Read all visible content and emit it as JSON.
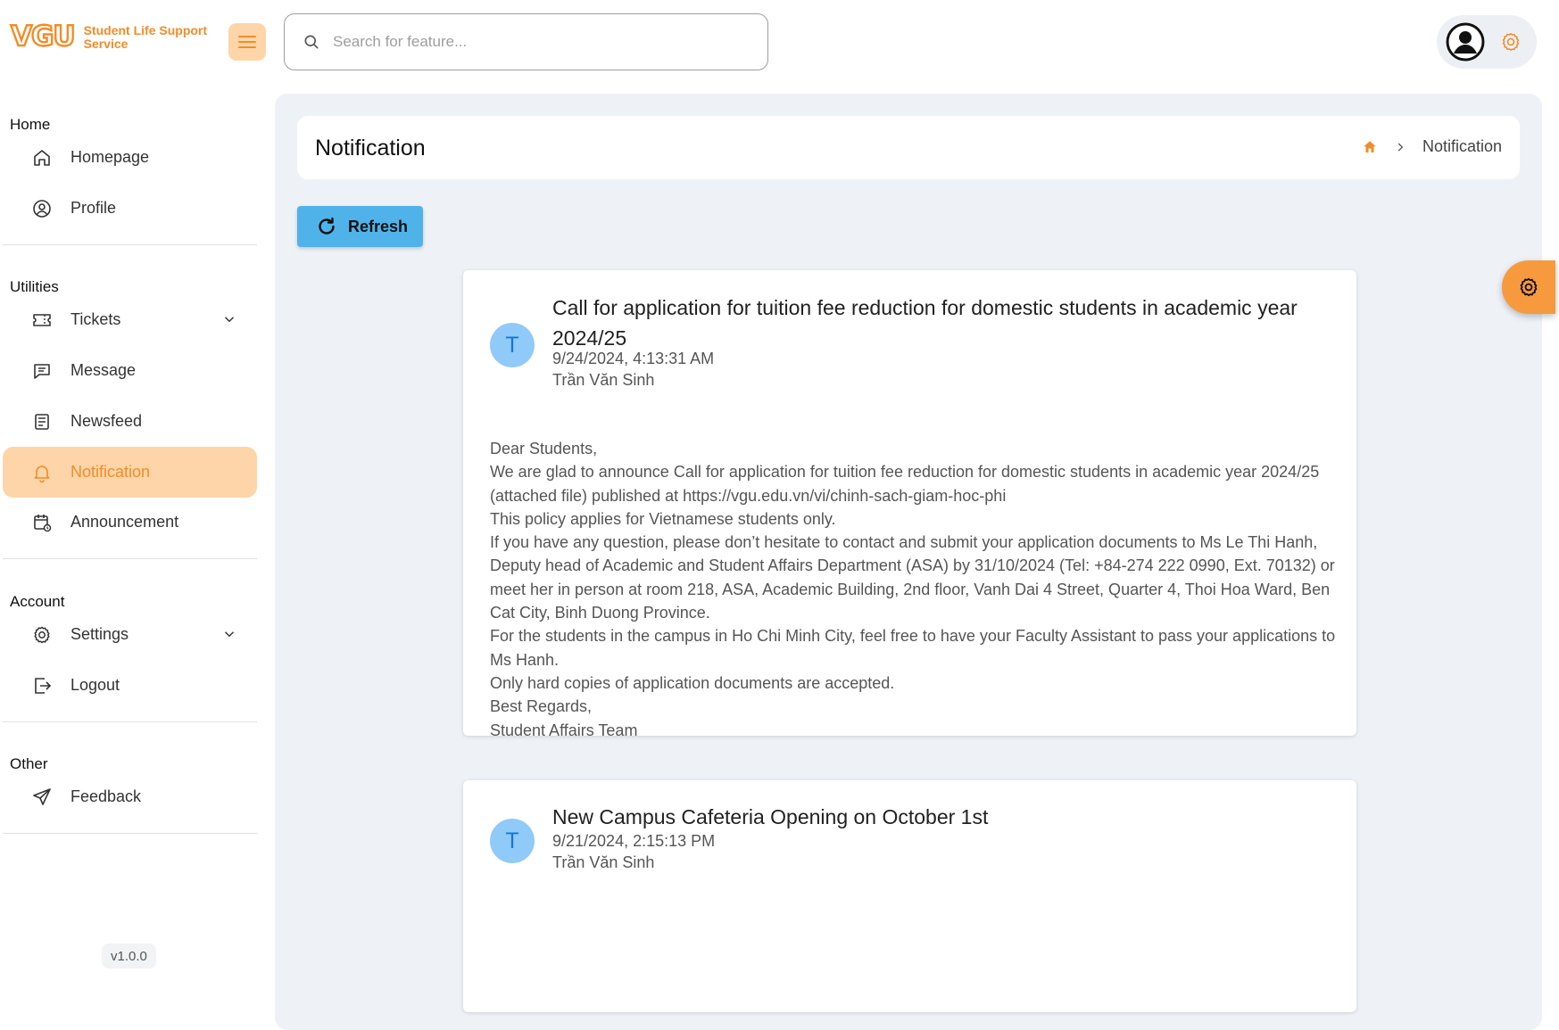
{
  "brand": {
    "logo_text": "VGU",
    "line1": "Student Life Support",
    "line2": "Service"
  },
  "search": {
    "placeholder": "Search for feature..."
  },
  "sidebar": {
    "sections": {
      "home": "Home",
      "utilities": "Utilities",
      "account": "Account",
      "other": "Other"
    },
    "items": {
      "homepage": "Homepage",
      "profile": "Profile",
      "tickets": "Tickets",
      "message": "Message",
      "newsfeed": "Newsfeed",
      "notification": "Notification",
      "announcement": "Announcement",
      "settings": "Settings",
      "logout": "Logout",
      "feedback": "Feedback"
    },
    "active": "notification",
    "version": "v1.0.0"
  },
  "main": {
    "page_title": "Notification",
    "breadcrumb_current": "Notification",
    "refresh_label": "Refresh",
    "notifications": [
      {
        "avatar_letter": "T",
        "title": "Call for application for tuition fee reduction for domestic students in academic year 2024/25",
        "date": "9/24/2024, 4:13:31 AM",
        "author": "Trần Văn Sinh",
        "body": [
          "Dear Students,",
          "We are glad to announce Call for application for tuition fee reduction for domestic students in academic year 2024/25 (attached file) published at https://vgu.edu.vn/vi/chinh-sach-giam-hoc-phi",
          "This policy applies for Vietnamese students only.",
          "If you have any question, please don’t hesitate to contact and submit your application documents to Ms Le Thi Hanh, Deputy head of Academic and Student Affairs Department (ASA) by 31/10/2024 (Tel: +84-274 222 0990, Ext. 70132) or meet her in person at room 218, ASA, Academic Building, 2nd floor, Vanh Dai 4 Street, Quarter 4, Thoi Hoa Ward, Ben Cat City, Binh Duong Province.",
          "For the students in the campus in Ho Chi Minh City, feel free to have your Faculty Assistant to pass your applications to Ms Hanh.",
          "Only hard copies of application documents are accepted.",
          "Best Regards,",
          "Student Affairs Team"
        ]
      },
      {
        "avatar_letter": "T",
        "title": "New Campus Cafeteria Opening on October 1st",
        "date": "9/21/2024, 2:15:13 PM",
        "author": "Trần Văn Sinh"
      }
    ]
  },
  "colors": {
    "accent": "#f28c28",
    "accent_light": "#fdd5a9",
    "refresh": "#4fb3ea",
    "avatar_bg": "#90caf9",
    "avatar_fg": "#1976d2",
    "content_bg": "#eef2f6"
  },
  "icons": [
    "menu-icon",
    "search-icon",
    "user-avatar-icon",
    "gear-icon",
    "home-icon",
    "profile-icon",
    "ticket-icon",
    "message-icon",
    "newsfeed-icon",
    "bell-icon",
    "calendar-icon",
    "logout-icon",
    "send-icon",
    "chevron-down-icon",
    "chevron-right-icon",
    "refresh-icon"
  ]
}
